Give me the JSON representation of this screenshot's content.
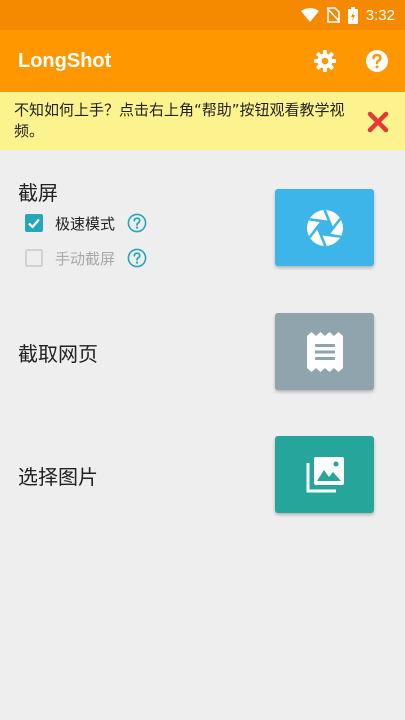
{
  "status_bar": {
    "time": "3:32"
  },
  "app_bar": {
    "title": "LongShot",
    "settings_icon": "gear-icon",
    "help_icon": "help-circle-icon"
  },
  "tip": {
    "text": "不知如何上手？点击右上角“帮助”按钮观看教学视频。",
    "close_icon": "close-icon"
  },
  "sections": {
    "screenshot": {
      "title": "截屏",
      "options": [
        {
          "label": "极速模式",
          "checked": true
        },
        {
          "label": "手动截屏",
          "checked": false
        }
      ],
      "tile_color": "#3db5e9",
      "tile_icon": "shutter-icon"
    },
    "webpage": {
      "title": "截取网页",
      "tile_color": "#90a4ae",
      "tile_icon": "document-icon"
    },
    "pick_image": {
      "title": "选择图片",
      "tile_color": "#26a69a",
      "tile_icon": "gallery-icon"
    }
  },
  "colors": {
    "primary": "#ff9800",
    "status_bar": "#f58a00",
    "tip_background": "#fdf38e",
    "close_red": "#e53935",
    "accent": "#26a7b7"
  }
}
